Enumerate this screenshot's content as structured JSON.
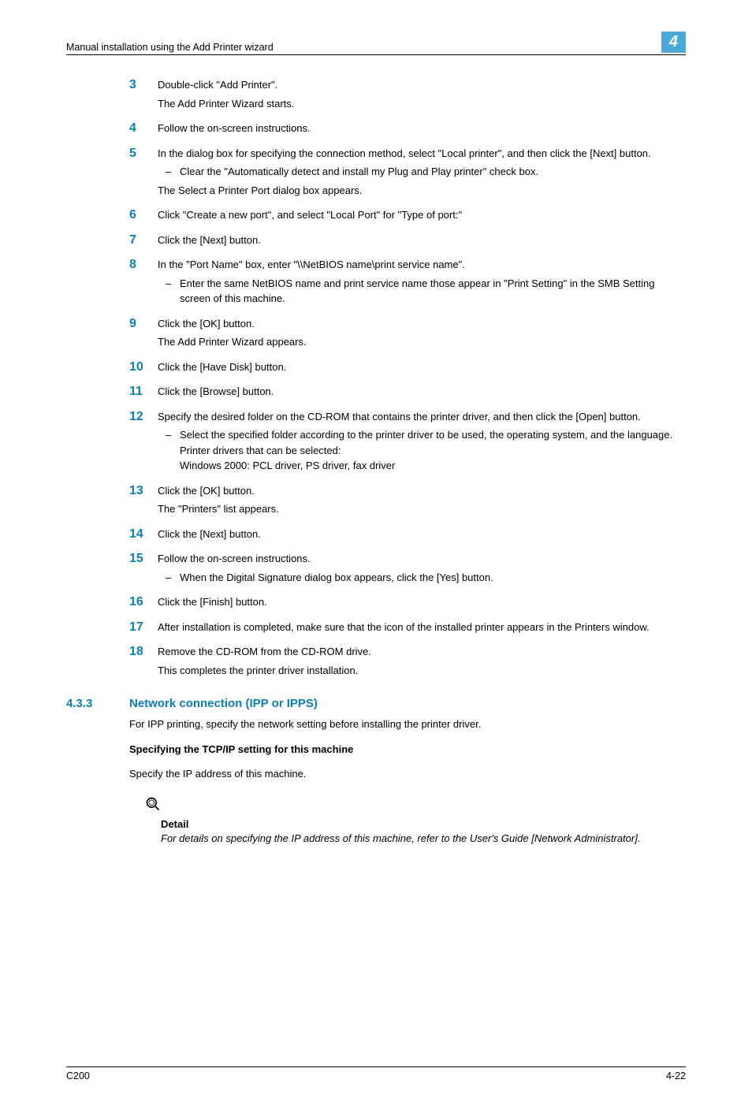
{
  "header": {
    "title": "Manual installation using the Add Printer wizard",
    "chapter": "4"
  },
  "steps": [
    {
      "num": "3",
      "paras": [
        "Double-click \"Add Printer\".",
        "The Add Printer Wizard starts."
      ],
      "subs": []
    },
    {
      "num": "4",
      "paras": [
        "Follow the on-screen instructions."
      ],
      "subs": []
    },
    {
      "num": "5",
      "paras": [
        "In the dialog box for specifying the connection method, select \"Local printer\", and then click the [Next] button."
      ],
      "subs": [
        {
          "text": "Clear the \"Automatically detect and install my Plug and Play printer\" check box."
        }
      ],
      "after": [
        "The Select a Printer Port dialog box appears."
      ]
    },
    {
      "num": "6",
      "paras": [
        "Click \"Create a new port\", and select \"Local Port\" for \"Type of port:\""
      ],
      "subs": []
    },
    {
      "num": "7",
      "paras": [
        "Click the [Next] button."
      ],
      "subs": []
    },
    {
      "num": "8",
      "paras": [
        "In the \"Port Name\" box, enter \"\\\\NetBIOS name\\print service name\"."
      ],
      "subs": [
        {
          "text": "Enter the same NetBIOS name and print service name those appear in \"Print Setting\" in the SMB Setting screen of this machine."
        }
      ]
    },
    {
      "num": "9",
      "paras": [
        "Click the [OK] button.",
        "The Add Printer Wizard appears."
      ],
      "subs": []
    },
    {
      "num": "10",
      "paras": [
        "Click the [Have Disk] button."
      ],
      "subs": []
    },
    {
      "num": "11",
      "paras": [
        "Click the [Browse] button."
      ],
      "subs": []
    },
    {
      "num": "12",
      "paras": [
        "Specify the desired folder on the CD-ROM that contains the printer driver, and then click the [Open] button."
      ],
      "subs": [
        {
          "text": "Select the specified folder according to the printer driver to be used, the operating system, and the language.",
          "extra": [
            "Printer drivers that can be selected:",
            "Windows 2000: PCL driver, PS driver, fax driver"
          ]
        }
      ]
    },
    {
      "num": "13",
      "paras": [
        "Click the [OK] button.",
        "The \"Printers\" list appears."
      ],
      "subs": []
    },
    {
      "num": "14",
      "paras": [
        "Click the [Next] button."
      ],
      "subs": []
    },
    {
      "num": "15",
      "paras": [
        "Follow the on-screen instructions."
      ],
      "subs": [
        {
          "text": "When the Digital Signature dialog box appears, click the [Yes] button."
        }
      ]
    },
    {
      "num": "16",
      "paras": [
        "Click the [Finish] button."
      ],
      "subs": []
    },
    {
      "num": "17",
      "paras": [
        "After installation is completed, make sure that the icon of the installed printer appears in the Printers window."
      ],
      "subs": []
    },
    {
      "num": "18",
      "paras": [
        "Remove the CD-ROM from the CD-ROM drive.",
        "This completes the printer driver installation."
      ],
      "subs": []
    }
  ],
  "section": {
    "number": "4.3.3",
    "title": "Network connection (IPP or IPPS)",
    "intro": "For IPP printing, specify the network setting before installing the printer driver.",
    "subhead": "Specifying the TCP/IP setting for this machine",
    "subtext": "Specify the IP address of this machine."
  },
  "detail": {
    "label": "Detail",
    "text": "For details on specifying the IP address of this machine, refer to the User's Guide [Network Administrator]."
  },
  "footer": {
    "left": "C200",
    "right": "4-22"
  }
}
